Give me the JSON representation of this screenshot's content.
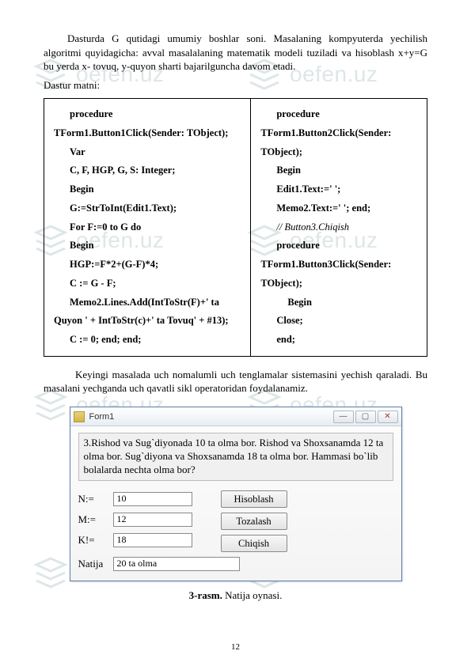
{
  "watermark_text": "oefen.uz",
  "para1": "Dasturda G qutidagi umumiy boshlar soni. Masalaning kompyuterda yechilish algoritmi quyidagicha: avval masalalaning matematik modeli tuziladi va hisoblash x+y=G bu yerda x- tovuq, y-quyon sharti bajarilguncha davom etadi.",
  "para2": "Dastur matni:",
  "code": {
    "left": {
      "l0": "procedure",
      "l1": "TForm1.Button1Click(Sender: TObject);",
      "l2": "Var",
      "l3": "C, F, HGP, G, S: Integer;",
      "l4": "Begin",
      "l5": "G:=StrToInt(Edit1.Text);",
      "l6": "For F:=0 to G do",
      "l7": "Begin",
      "l8": "HGP:=F*2+(G-F)*4;",
      "l9": "C := G - F;",
      "l10": "Memo2.Lines.Add(IntToStr(F)+'   ta",
      "l11": "Quyon ' + IntToStr(c)+' ta Tovuq' + #13);",
      "l12": "C := 0; end;   end;"
    },
    "right": {
      "l0": "procedure",
      "l1": "TForm1.Button2Click(Sender:",
      "l2": "TObject);",
      "l3": "Begin",
      "l4": "Edit1.Text:=' ';",
      "l5": "Memo2.Text:=' '; end;",
      "l6": "// Button3.Chiqish",
      "l7": "procedure",
      "l8": "TForm1.Button3Click(Sender:",
      "l9": "TObject);",
      "l10": "Begin",
      "l11": "Close;",
      "l12": "end;"
    }
  },
  "after_table": "Keyingi masalada uch nomalumli uch tenglamalar sistemasini yechish qaraladi. Bu masalani yechganda uch qavatli sikl operatoridan foydalanamiz.",
  "form": {
    "title": "Form1",
    "question": "3.Rishod va Sug`diyonada  10 ta olma bor. Rishod va Shoxsanamda 12 ta olma bor. Sug`diyona va Shoxsanamda 18 ta olma bor. Hammasi bo`lib bolalarda nechta olma bor?",
    "labels": {
      "n": "N:=",
      "m": "M:=",
      "k": "K!=",
      "natija": "Natija"
    },
    "values": {
      "n": "10",
      "m": "12",
      "k": "18",
      "result": "20 ta olma"
    },
    "buttons": {
      "calc": "Hisoblash",
      "clear": "Tozalash",
      "exit": "Chiqish"
    }
  },
  "caption_bold": "3-rasm.",
  "caption_rest": " Natija oynasi.",
  "page_number": "12"
}
